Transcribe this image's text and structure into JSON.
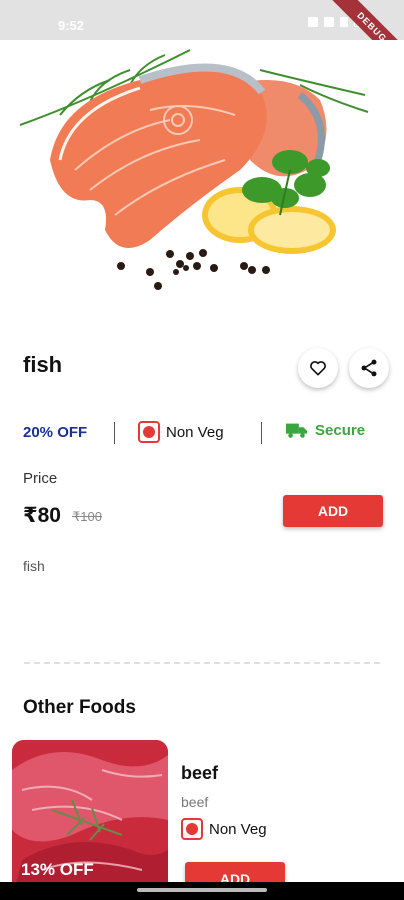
{
  "status_bar": {
    "time": "9:52",
    "debug_label": "DEBUG"
  },
  "product": {
    "name": "fish",
    "discount": "20% OFF",
    "type_label": "Non Veg",
    "secure_label": "Secure",
    "price_label": "Price",
    "price": "₹80",
    "old_price": "₹100",
    "add_label": "ADD",
    "description": "fish"
  },
  "other_foods": {
    "title": "Other Foods",
    "items": [
      {
        "name": "beef",
        "subtitle": "beef",
        "type_label": "Non Veg",
        "discount": "13% OFF",
        "add_label": "ADD"
      }
    ]
  },
  "colors": {
    "accent": "#e53935",
    "discount": "#1a2f9e",
    "secure": "#3aa63f"
  },
  "icons": [
    "heart-icon",
    "share-icon",
    "non-veg-icon",
    "truck-icon"
  ]
}
